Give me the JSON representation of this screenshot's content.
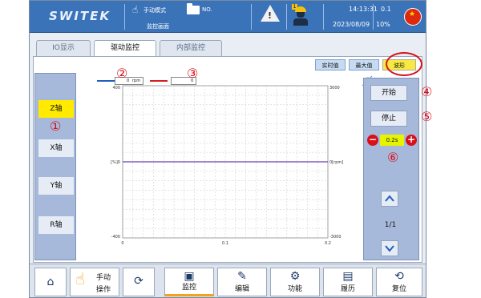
{
  "header": {
    "brand": "SWITEK",
    "mode": "手动模式",
    "screen": "监控画面",
    "program_no": "NO.",
    "time": "14:13:31",
    "date": "2023/08/09",
    "value_top": "0.1",
    "value_pct": "10%",
    "worker_badge": "1",
    "warning_mark": "!",
    "flag_star": "★"
  },
  "tabs": [
    {
      "label": "IO显示"
    },
    {
      "label": "驱动监控"
    },
    {
      "label": "内部监控"
    }
  ],
  "toggles": {
    "realtime": "实时值",
    "maxval": "最大值",
    "wave": "波形"
  },
  "axes": [
    {
      "label": "Z轴"
    },
    {
      "label": "X轴"
    },
    {
      "label": "Y轴"
    },
    {
      "label": "R轴"
    }
  ],
  "markers": {
    "m1": "①",
    "m2": "②",
    "m3": "③",
    "m4": "④",
    "m5": "⑤",
    "m6": "⑥"
  },
  "legend": {
    "series1_value": "0",
    "series1_unit": "rpm",
    "series2_value": "0"
  },
  "controls": {
    "start": "开始",
    "stop": "停止",
    "minus": "−",
    "plus": "+",
    "step": "0.2s",
    "page": "1/1"
  },
  "nav": {
    "manual_line1": "手动",
    "manual_line2": "操作",
    "monitor": "监控",
    "edit": "编辑",
    "function": "功能",
    "history": "履历",
    "reset": "复位"
  },
  "colors": {
    "header_bg": "#3a73b8",
    "selected_axis": "#ffea00",
    "annotation_red": "#d8101a",
    "series1": "#1e5fbf",
    "series2": "#d42020",
    "trace": "#6a3fb0"
  },
  "chart_data": {
    "type": "line",
    "x_ticks": [
      "0",
      "0.1",
      "0.2"
    ],
    "y_left_ticks": [
      "400",
      "0",
      "-400"
    ],
    "y_left_label": "[%]",
    "y_right_ticks": [
      "3000",
      "0",
      "-3000"
    ],
    "y_right_label": "[rpm]",
    "ylim_left": [
      -400,
      400
    ],
    "ylim_right": [
      -3000,
      3000
    ],
    "xlim": [
      0,
      0.2
    ],
    "grid": true,
    "series": [
      {
        "x": [
          0,
          0.2
        ],
        "values": [
          0,
          0
        ]
      }
    ]
  }
}
